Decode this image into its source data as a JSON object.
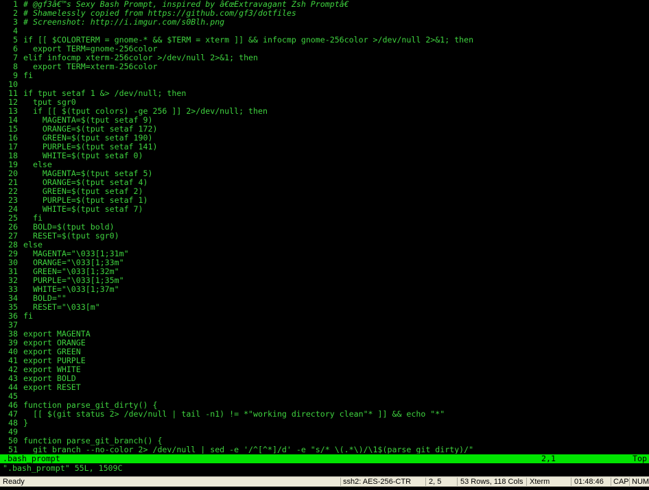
{
  "editor": {
    "lines": [
      {
        "n": "1",
        "t": "# @gf3â€™s Sexy Bash Prompt, inspired by â€œExtravagant Zsh Promptâ€",
        "comment": true
      },
      {
        "n": "2",
        "t": "# Shamelessly copied from https://github.com/gf3/dotfiles",
        "comment": true
      },
      {
        "n": "3",
        "t": "# Screenshot: http://i.imgur.com/s0Blh.png",
        "comment": true
      },
      {
        "n": "4",
        "t": ""
      },
      {
        "n": "5",
        "t": "if [[ $COLORTERM = gnome-* && $TERM = xterm ]] && infocmp gnome-256color >/dev/null 2>&1; then"
      },
      {
        "n": "6",
        "t": "  export TERM=gnome-256color"
      },
      {
        "n": "7",
        "t": "elif infocmp xterm-256color >/dev/null 2>&1; then"
      },
      {
        "n": "8",
        "t": "  export TERM=xterm-256color"
      },
      {
        "n": "9",
        "t": "fi"
      },
      {
        "n": "10",
        "t": ""
      },
      {
        "n": "11",
        "t": "if tput setaf 1 &> /dev/null; then"
      },
      {
        "n": "12",
        "t": "  tput sgr0"
      },
      {
        "n": "13",
        "t": "  if [[ $(tput colors) -ge 256 ]] 2>/dev/null; then"
      },
      {
        "n": "14",
        "t": "    MAGENTA=$(tput setaf 9)"
      },
      {
        "n": "15",
        "t": "    ORANGE=$(tput setaf 172)"
      },
      {
        "n": "16",
        "t": "    GREEN=$(tput setaf 190)"
      },
      {
        "n": "17",
        "t": "    PURPLE=$(tput setaf 141)"
      },
      {
        "n": "18",
        "t": "    WHITE=$(tput setaf 0)"
      },
      {
        "n": "19",
        "t": "  else"
      },
      {
        "n": "20",
        "t": "    MAGENTA=$(tput setaf 5)"
      },
      {
        "n": "21",
        "t": "    ORANGE=$(tput setaf 4)"
      },
      {
        "n": "22",
        "t": "    GREEN=$(tput setaf 2)"
      },
      {
        "n": "23",
        "t": "    PURPLE=$(tput setaf 1)"
      },
      {
        "n": "24",
        "t": "    WHITE=$(tput setaf 7)"
      },
      {
        "n": "25",
        "t": "  fi"
      },
      {
        "n": "26",
        "t": "  BOLD=$(tput bold)"
      },
      {
        "n": "27",
        "t": "  RESET=$(tput sgr0)"
      },
      {
        "n": "28",
        "t": "else"
      },
      {
        "n": "29",
        "t": "  MAGENTA=\"\\033[1;31m\""
      },
      {
        "n": "30",
        "t": "  ORANGE=\"\\033[1;33m\""
      },
      {
        "n": "31",
        "t": "  GREEN=\"\\033[1;32m\""
      },
      {
        "n": "32",
        "t": "  PURPLE=\"\\033[1;35m\""
      },
      {
        "n": "33",
        "t": "  WHITE=\"\\033[1;37m\""
      },
      {
        "n": "34",
        "t": "  BOLD=\"\""
      },
      {
        "n": "35",
        "t": "  RESET=\"\\033[m\""
      },
      {
        "n": "36",
        "t": "fi"
      },
      {
        "n": "37",
        "t": ""
      },
      {
        "n": "38",
        "t": "export MAGENTA"
      },
      {
        "n": "39",
        "t": "export ORANGE"
      },
      {
        "n": "40",
        "t": "export GREEN"
      },
      {
        "n": "41",
        "t": "export PURPLE"
      },
      {
        "n": "42",
        "t": "export WHITE"
      },
      {
        "n": "43",
        "t": "export BOLD"
      },
      {
        "n": "44",
        "t": "export RESET"
      },
      {
        "n": "45",
        "t": ""
      },
      {
        "n": "46",
        "t": "function parse_git_dirty() {"
      },
      {
        "n": "47",
        "t": "  [[ $(git status 2> /dev/null | tail -n1) != *\"working directory clean\"* ]] && echo \"*\""
      },
      {
        "n": "48",
        "t": "}"
      },
      {
        "n": "49",
        "t": ""
      },
      {
        "n": "50",
        "t": "function parse_git_branch() {"
      },
      {
        "n": "51",
        "t": "  git branch --no-color 2> /dev/null | sed -e '/^[^*]/d' -e \"s/* \\(.*\\)/\\1$(parse_git_dirty)/\""
      }
    ]
  },
  "statusline": {
    "filename": ".bash_prompt",
    "position": "2,1",
    "scroll": "Top"
  },
  "cmdline": {
    "message": "\".bash_prompt\" 55L, 1509C"
  },
  "appstatus": {
    "ready": "Ready",
    "cipher": "ssh2: AES-256-CTR",
    "cursor": "2,  5",
    "size": "53 Rows, 118 Cols",
    "terminal": "Xterm",
    "clock": "01:48:46",
    "caps": "CAP",
    "num": "NUM"
  },
  "colors": {
    "foreground": "#3fd33f",
    "background": "#000000",
    "statusline_bg": "#00e400",
    "appbar_bg": "#ece9d8"
  }
}
